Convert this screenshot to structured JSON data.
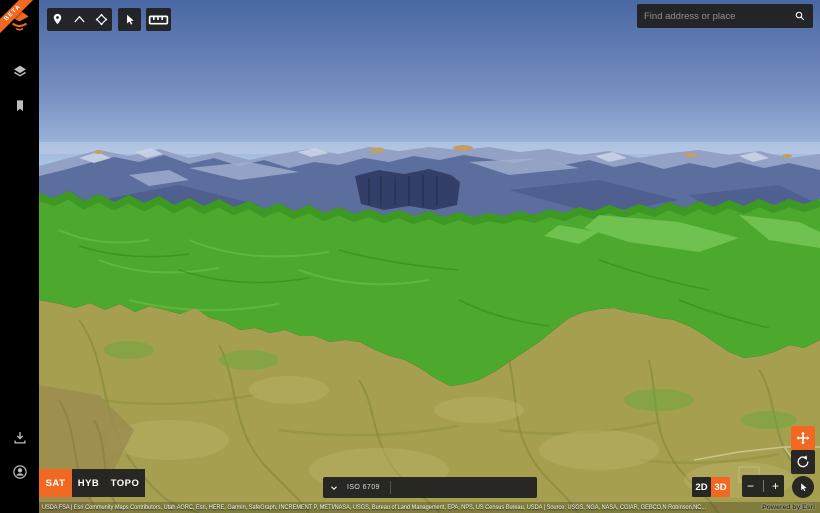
{
  "app": {
    "beta_label": "BETA",
    "logo_name": "equator-logo"
  },
  "sidebar": {
    "top_icons": [
      "layers-icon",
      "bookmark-icon"
    ],
    "bottom_icons": [
      "download-icon",
      "account-icon"
    ]
  },
  "toolbar": {
    "draw_tools": [
      {
        "icon": "pin-icon"
      },
      {
        "icon": "polyline-icon"
      },
      {
        "icon": "polygon-icon"
      }
    ],
    "select_tool": {
      "icon": "cursor-icon"
    },
    "measure_tool": {
      "icon": "ruler-icon"
    }
  },
  "search": {
    "placeholder": "Find address or place",
    "icon": "search-icon"
  },
  "basemap": {
    "options": [
      {
        "label": "SAT",
        "selected": true
      },
      {
        "label": "HYB",
        "selected": false
      },
      {
        "label": "TOPO",
        "selected": false
      }
    ]
  },
  "coordinates": {
    "format_label": "ISO 6709",
    "value": "",
    "dropdown_icon": "chevron-down-icon"
  },
  "view_mode": {
    "options": [
      {
        "label": "2D",
        "selected": false
      },
      {
        "label": "3D",
        "selected": true
      }
    ]
  },
  "zoom_control": {
    "zoom_out_label": "−",
    "zoom_in_label": "+"
  },
  "nav_controls": {
    "pan_icon": "move-icon",
    "rotate_icon": "rotate-ccw-icon",
    "pointer_icon": "cursor-icon"
  },
  "attribution": {
    "sources": "USDA FSA | Esri Community Maps Contributors, Utah AGRC, Esri, HERE, Garmin, SafeGraph, INCREMENT P, METI/NASA, USGS, Bureau of Land Management, EPA, NPS, US Census Bureau, USDA | Source: USGS, NGA, NASA, CGIAR, GEBCO,N Robinson,NC...",
    "powered_by": "Powered by Esri"
  },
  "colors": {
    "accent_orange": "#f16823",
    "panel_dark": "#212121",
    "sky_top": "#4967a3",
    "sky_horizon": "#bad2ee",
    "mountain_blue": "#5c6e9d",
    "overlay_green": "#4ca92d",
    "terrain_olive": "#a59f4f"
  }
}
